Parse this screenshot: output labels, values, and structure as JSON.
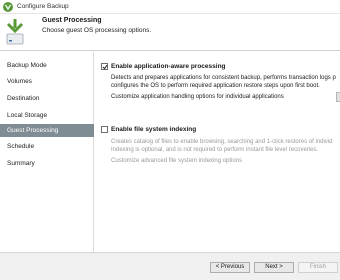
{
  "window": {
    "title": "Configure Backup"
  },
  "header": {
    "title": "Guest Processing",
    "subtitle": "Choose guest OS processing options."
  },
  "sidebar": {
    "items": [
      {
        "label": "Backup Mode"
      },
      {
        "label": "Volumes"
      },
      {
        "label": "Destination"
      },
      {
        "label": "Local Storage"
      },
      {
        "label": "Guest Processing"
      },
      {
        "label": "Schedule"
      },
      {
        "label": "Summary"
      }
    ]
  },
  "options": {
    "aware": {
      "label": "Enable application-aware processing",
      "checked": true,
      "desc_line1": "Detects and prepares applications for consistent backup, performs transaction logs p",
      "desc_line2": "configures the OS to perform required application restore steps upon first boot.",
      "link": "Customize application handling options for individual applications"
    },
    "indexing": {
      "label": "Enable file system indexing",
      "checked": false,
      "desc_line1": "Creates catalog of files to enable browsing, searching and 1-click restores of individ",
      "desc_line2": "Indexing is optional, and is not required to perform instant file level recoveries.",
      "link": "Customize advanced file system indexing options"
    }
  },
  "footer": {
    "previous": "< Previous",
    "next": "Next >",
    "finish": "Finish"
  },
  "colors": {
    "accent_green": "#5a9a3a",
    "active_nav": "#7f8c93",
    "disabled_text": "#9a9a9a"
  },
  "icons": {
    "app": "veeam-logo-icon",
    "header": "download-arrow-icon"
  }
}
